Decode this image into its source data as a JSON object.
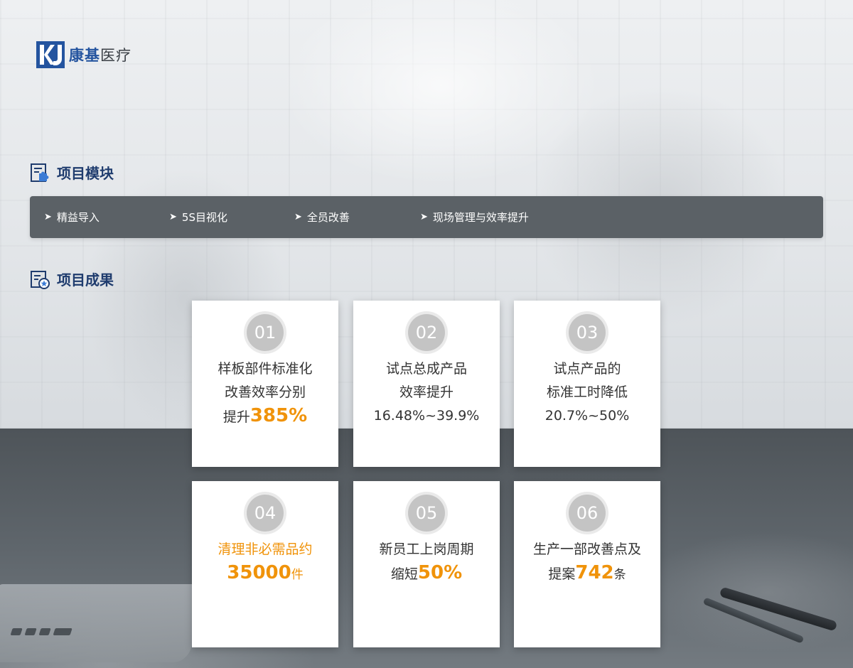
{
  "brand": {
    "name_main": "康基",
    "name_tail": "医疗",
    "primary_color": "#24549f",
    "accent_color": "#f0930a",
    "bar_color": "#5b6166"
  },
  "sections": {
    "modules_title": "项目模块",
    "results_title": "项目成果"
  },
  "modules": [
    {
      "label": "精益导入"
    },
    {
      "label": "5S目视化"
    },
    {
      "label": "全员改善"
    },
    {
      "label": "现场管理与效率提升"
    }
  ],
  "results": [
    {
      "num": "01",
      "line1": "样板部件标准化",
      "line2": "改善效率分别",
      "line3_prefix": "提升",
      "line3_value": "385%"
    },
    {
      "num": "02",
      "line1": "试点总成产品",
      "line2": "效率提升",
      "line3": "16.48%~39.9%"
    },
    {
      "num": "03",
      "line1": "试点产品的",
      "line2": "标准工时降低",
      "line3": "20.7%~50%"
    },
    {
      "num": "04",
      "line1": "清理非必需品约",
      "line2_value": "35000",
      "line2_suffix": "件"
    },
    {
      "num": "05",
      "line1": "新员工上岗周期",
      "line2_prefix": "缩短",
      "line2_value": "50%"
    },
    {
      "num": "06",
      "line1": "生产一部改善点及",
      "line2_prefix": "提案",
      "line2_value": "742",
      "line2_suffix": "条"
    }
  ]
}
